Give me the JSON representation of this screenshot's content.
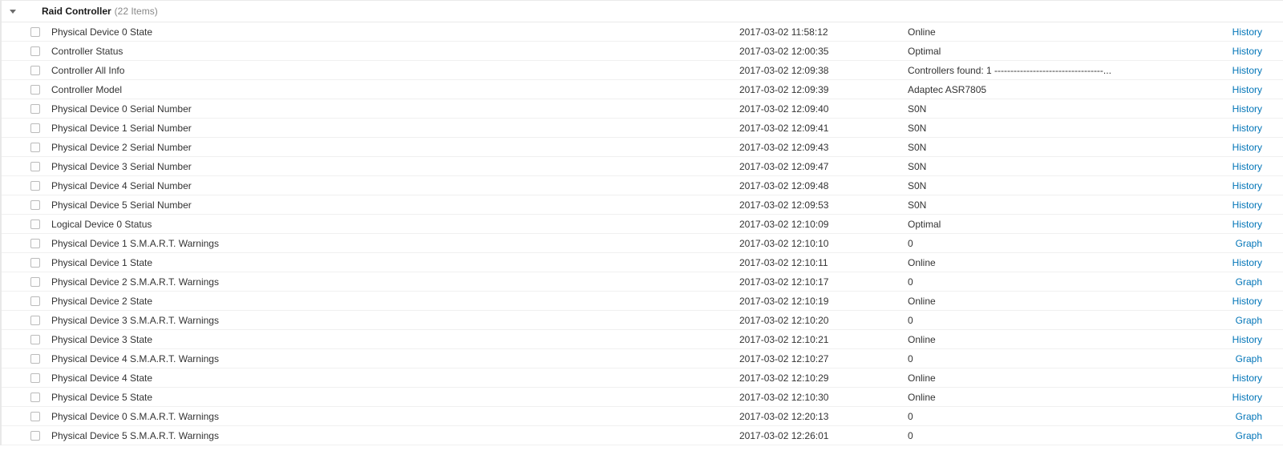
{
  "group": {
    "name": "Raid Controller",
    "count_label": "(22 Items)"
  },
  "items": [
    {
      "name": "Physical Device 0 State",
      "ts": "2017-03-02 11:58:12",
      "value": "Online",
      "action": "History"
    },
    {
      "name": "Controller Status",
      "ts": "2017-03-02 12:00:35",
      "value": "Optimal",
      "action": "History"
    },
    {
      "name": "Controller All Info",
      "ts": "2017-03-02 12:09:38",
      "value": "Controllers found: 1 ----------------------------------...",
      "action": "History"
    },
    {
      "name": "Controller Model",
      "ts": "2017-03-02 12:09:39",
      "value": "Adaptec ASR7805",
      "action": "History"
    },
    {
      "name": "Physical Device 0 Serial Number",
      "ts": "2017-03-02 12:09:40",
      "value": "S0N",
      "action": "History"
    },
    {
      "name": "Physical Device 1 Serial Number",
      "ts": "2017-03-02 12:09:41",
      "value": "S0N",
      "action": "History"
    },
    {
      "name": "Physical Device 2 Serial Number",
      "ts": "2017-03-02 12:09:43",
      "value": "S0N",
      "action": "History"
    },
    {
      "name": "Physical Device 3 Serial Number",
      "ts": "2017-03-02 12:09:47",
      "value": "S0N",
      "action": "History"
    },
    {
      "name": "Physical Device 4 Serial Number",
      "ts": "2017-03-02 12:09:48",
      "value": "S0N",
      "action": "History"
    },
    {
      "name": "Physical Device 5 Serial Number",
      "ts": "2017-03-02 12:09:53",
      "value": "S0N",
      "action": "History"
    },
    {
      "name": "Logical Device 0 Status",
      "ts": "2017-03-02 12:10:09",
      "value": "Optimal",
      "action": "History"
    },
    {
      "name": "Physical Device 1 S.M.A.R.T. Warnings",
      "ts": "2017-03-02 12:10:10",
      "value": "0",
      "action": "Graph"
    },
    {
      "name": "Physical Device 1 State",
      "ts": "2017-03-02 12:10:11",
      "value": "Online",
      "action": "History"
    },
    {
      "name": "Physical Device 2 S.M.A.R.T. Warnings",
      "ts": "2017-03-02 12:10:17",
      "value": "0",
      "action": "Graph"
    },
    {
      "name": "Physical Device 2 State",
      "ts": "2017-03-02 12:10:19",
      "value": "Online",
      "action": "History"
    },
    {
      "name": "Physical Device 3 S.M.A.R.T. Warnings",
      "ts": "2017-03-02 12:10:20",
      "value": "0",
      "action": "Graph"
    },
    {
      "name": "Physical Device 3 State",
      "ts": "2017-03-02 12:10:21",
      "value": "Online",
      "action": "History"
    },
    {
      "name": "Physical Device 4 S.M.A.R.T. Warnings",
      "ts": "2017-03-02 12:10:27",
      "value": "0",
      "action": "Graph"
    },
    {
      "name": "Physical Device 4 State",
      "ts": "2017-03-02 12:10:29",
      "value": "Online",
      "action": "History"
    },
    {
      "name": "Physical Device 5 State",
      "ts": "2017-03-02 12:10:30",
      "value": "Online",
      "action": "History"
    },
    {
      "name": "Physical Device 0 S.M.A.R.T. Warnings",
      "ts": "2017-03-02 12:20:13",
      "value": "0",
      "action": "Graph"
    },
    {
      "name": "Physical Device 5 S.M.A.R.T. Warnings",
      "ts": "2017-03-02 12:26:01",
      "value": "0",
      "action": "Graph"
    }
  ]
}
